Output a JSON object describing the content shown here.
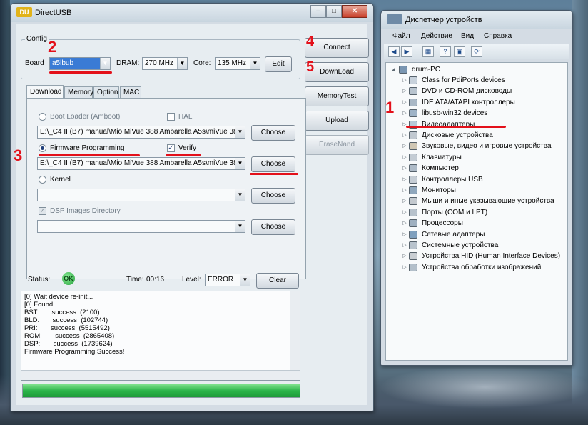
{
  "directusb": {
    "title": "DirectUSB",
    "app_icon": "DU",
    "controls": {
      "minimize": "–",
      "maximize": "□",
      "close": "✕"
    },
    "config": {
      "legend": "Config",
      "board_label": "Board",
      "board_value": "a5lbub",
      "dram_label": "DRAM:",
      "dram_value": "270 MHz",
      "core_label": "Core:",
      "core_value": "135 MHz",
      "edit_label": "Edit"
    },
    "side_buttons": {
      "connect": "Connect",
      "download": "DownLoad",
      "memory_test": "MemoryTest",
      "upload": "Upload",
      "erase_nand": "EraseNand"
    },
    "tabs": [
      "Download",
      "Memory",
      "Option",
      "MAC"
    ],
    "download_tab": {
      "boot_loader_label": "Boot Loader (Amboot)",
      "hal_label": "HAL",
      "boot_loader_path": "E:\\_C4 II (B7) manual\\Mio MiVue 388 Ambarella A5s\\miVue 388 v2 (",
      "firmware_label": "Firmware Programming",
      "verify_label": "Verify",
      "firmware_path": "E:\\_C4 II (B7) manual\\Mio MiVue 388 Ambarella A5s\\miVue 388 v2 (",
      "kernel_label": "Kernel",
      "dsp_label": "DSP Images Directory",
      "choose_label": "Choose"
    },
    "status": {
      "status_label": "Status:",
      "status_value": "OK",
      "time_label": "Time:",
      "time_value": "00:16",
      "level_label": "Level:",
      "level_value": "ERROR",
      "clear_label": "Clear"
    },
    "log_lines": [
      "[0] Wait device re-init...",
      "[0] Found",
      "BST:       success  (2100)",
      "BLD:       success  (102744)",
      "PRI:       success  (5515492)",
      "ROM:       success  (2865408)",
      "DSP:       success  (1739624)",
      "Firmware Programming Success!"
    ],
    "progress": 100
  },
  "annotations": {
    "num_1": "1",
    "num_2": "2",
    "num_3": "3",
    "num_4": "4",
    "num_5": "5",
    "color": "#e3101a"
  },
  "device_manager": {
    "title": "Диспетчер устройств",
    "menu": [
      "Файл",
      "Действие",
      "Вид",
      "Справка"
    ],
    "toolbar_icons": [
      "back-icon",
      "forward-icon",
      "properties-icon",
      "help-icon",
      "scan-icon",
      "refresh-icon"
    ],
    "root": "drum-PC",
    "items": [
      "Class for PdiPorts devices",
      "DVD и CD-ROM дисководы",
      "IDE ATA/ATAPI контроллеры",
      "libusb-win32 devices",
      "Видеоадаптеры",
      "Дисковые устройства",
      "Звуковые, видео и игровые устройства",
      "Клавиатуры",
      "Компьютер",
      "Контроллеры USB",
      "Мониторы",
      "Мыши и иные указывающие устройства",
      "Порты (COM и LPT)",
      "Процессоры",
      "Сетевые адаптеры",
      "Системные устройства",
      "Устройства HID (Human Interface Devices)",
      "Устройства обработки изображений"
    ]
  }
}
